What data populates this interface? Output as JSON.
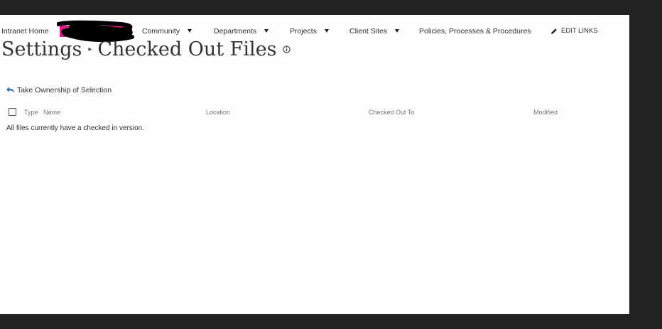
{
  "nav": {
    "items": [
      {
        "label": "Intranet Home",
        "has_dropdown": false
      },
      {
        "label": "Community",
        "has_dropdown": true
      },
      {
        "label": "Departments",
        "has_dropdown": true
      },
      {
        "label": "Projects",
        "has_dropdown": true
      },
      {
        "label": "Client Sites",
        "has_dropdown": true
      },
      {
        "label": "Policies, Processes & Procedures",
        "has_dropdown": false
      }
    ],
    "edit_links_label": "EDIT LINKS"
  },
  "breadcrumb": {
    "parent": "Settings",
    "separator": "▸",
    "current": "Checked Out Files"
  },
  "toolbar": {
    "take_ownership_label": "Take Ownership of Selection"
  },
  "table": {
    "columns": [
      "Type",
      "Name",
      "Location",
      "Checked Out To",
      "Modified"
    ],
    "empty_message": "All files currently have a checked in version."
  },
  "colors": {
    "page_bg": "#fdfdfd",
    "frame_bg": "#222222",
    "redaction_pink": "#e0188c",
    "redaction_black": "#000000",
    "icon_blue": "#2a6ebb"
  }
}
